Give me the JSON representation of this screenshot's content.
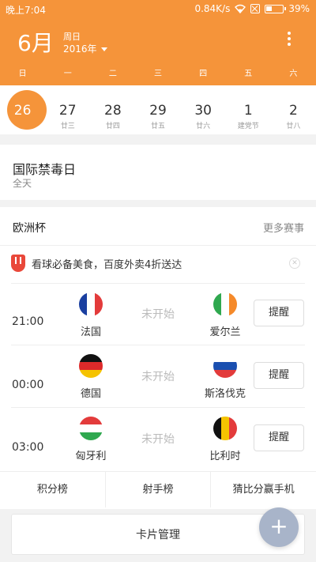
{
  "status_bar": {
    "time": "晚上7:04",
    "speed": "0.84K/s",
    "battery": "39%",
    "battery_level": 0.39
  },
  "header": {
    "month": "6月",
    "weekday_label": "周日",
    "year": "2016年",
    "weekdays": [
      "日",
      "一",
      "二",
      "三",
      "四",
      "五",
      "六"
    ]
  },
  "dates": [
    {
      "day": "26",
      "lunar": "",
      "active": true
    },
    {
      "day": "27",
      "lunar": "廿三"
    },
    {
      "day": "28",
      "lunar": "廿四"
    },
    {
      "day": "29",
      "lunar": "廿五"
    },
    {
      "day": "30",
      "lunar": "廿六"
    },
    {
      "day": "1",
      "lunar": "建党节"
    },
    {
      "day": "2",
      "lunar": "廿八"
    }
  ],
  "event": {
    "title": "国际禁毒日",
    "subtitle": "全天"
  },
  "euro": {
    "title": "欧洲杯",
    "more": "更多赛事",
    "promo": "看球必备美食，百度外卖4折送达",
    "matches": [
      {
        "time": "21:00",
        "home": "法国",
        "away": "爱尔兰",
        "status": "未开始",
        "button": "提醒"
      },
      {
        "time": "00:00",
        "home": "德国",
        "away": "斯洛伐克",
        "status": "未开始",
        "button": "提醒"
      },
      {
        "time": "03:00",
        "home": "匈牙利",
        "away": "比利时",
        "status": "未开始",
        "button": "提醒"
      }
    ]
  },
  "tabs": [
    "积分榜",
    "射手榜",
    "猜比分赢手机"
  ],
  "card_management": "卡片管理",
  "fab_symbol": "+",
  "colors": {
    "accent": "#f5943a",
    "fab": "#a8b4c9",
    "promo_icon": "#e9483a"
  }
}
